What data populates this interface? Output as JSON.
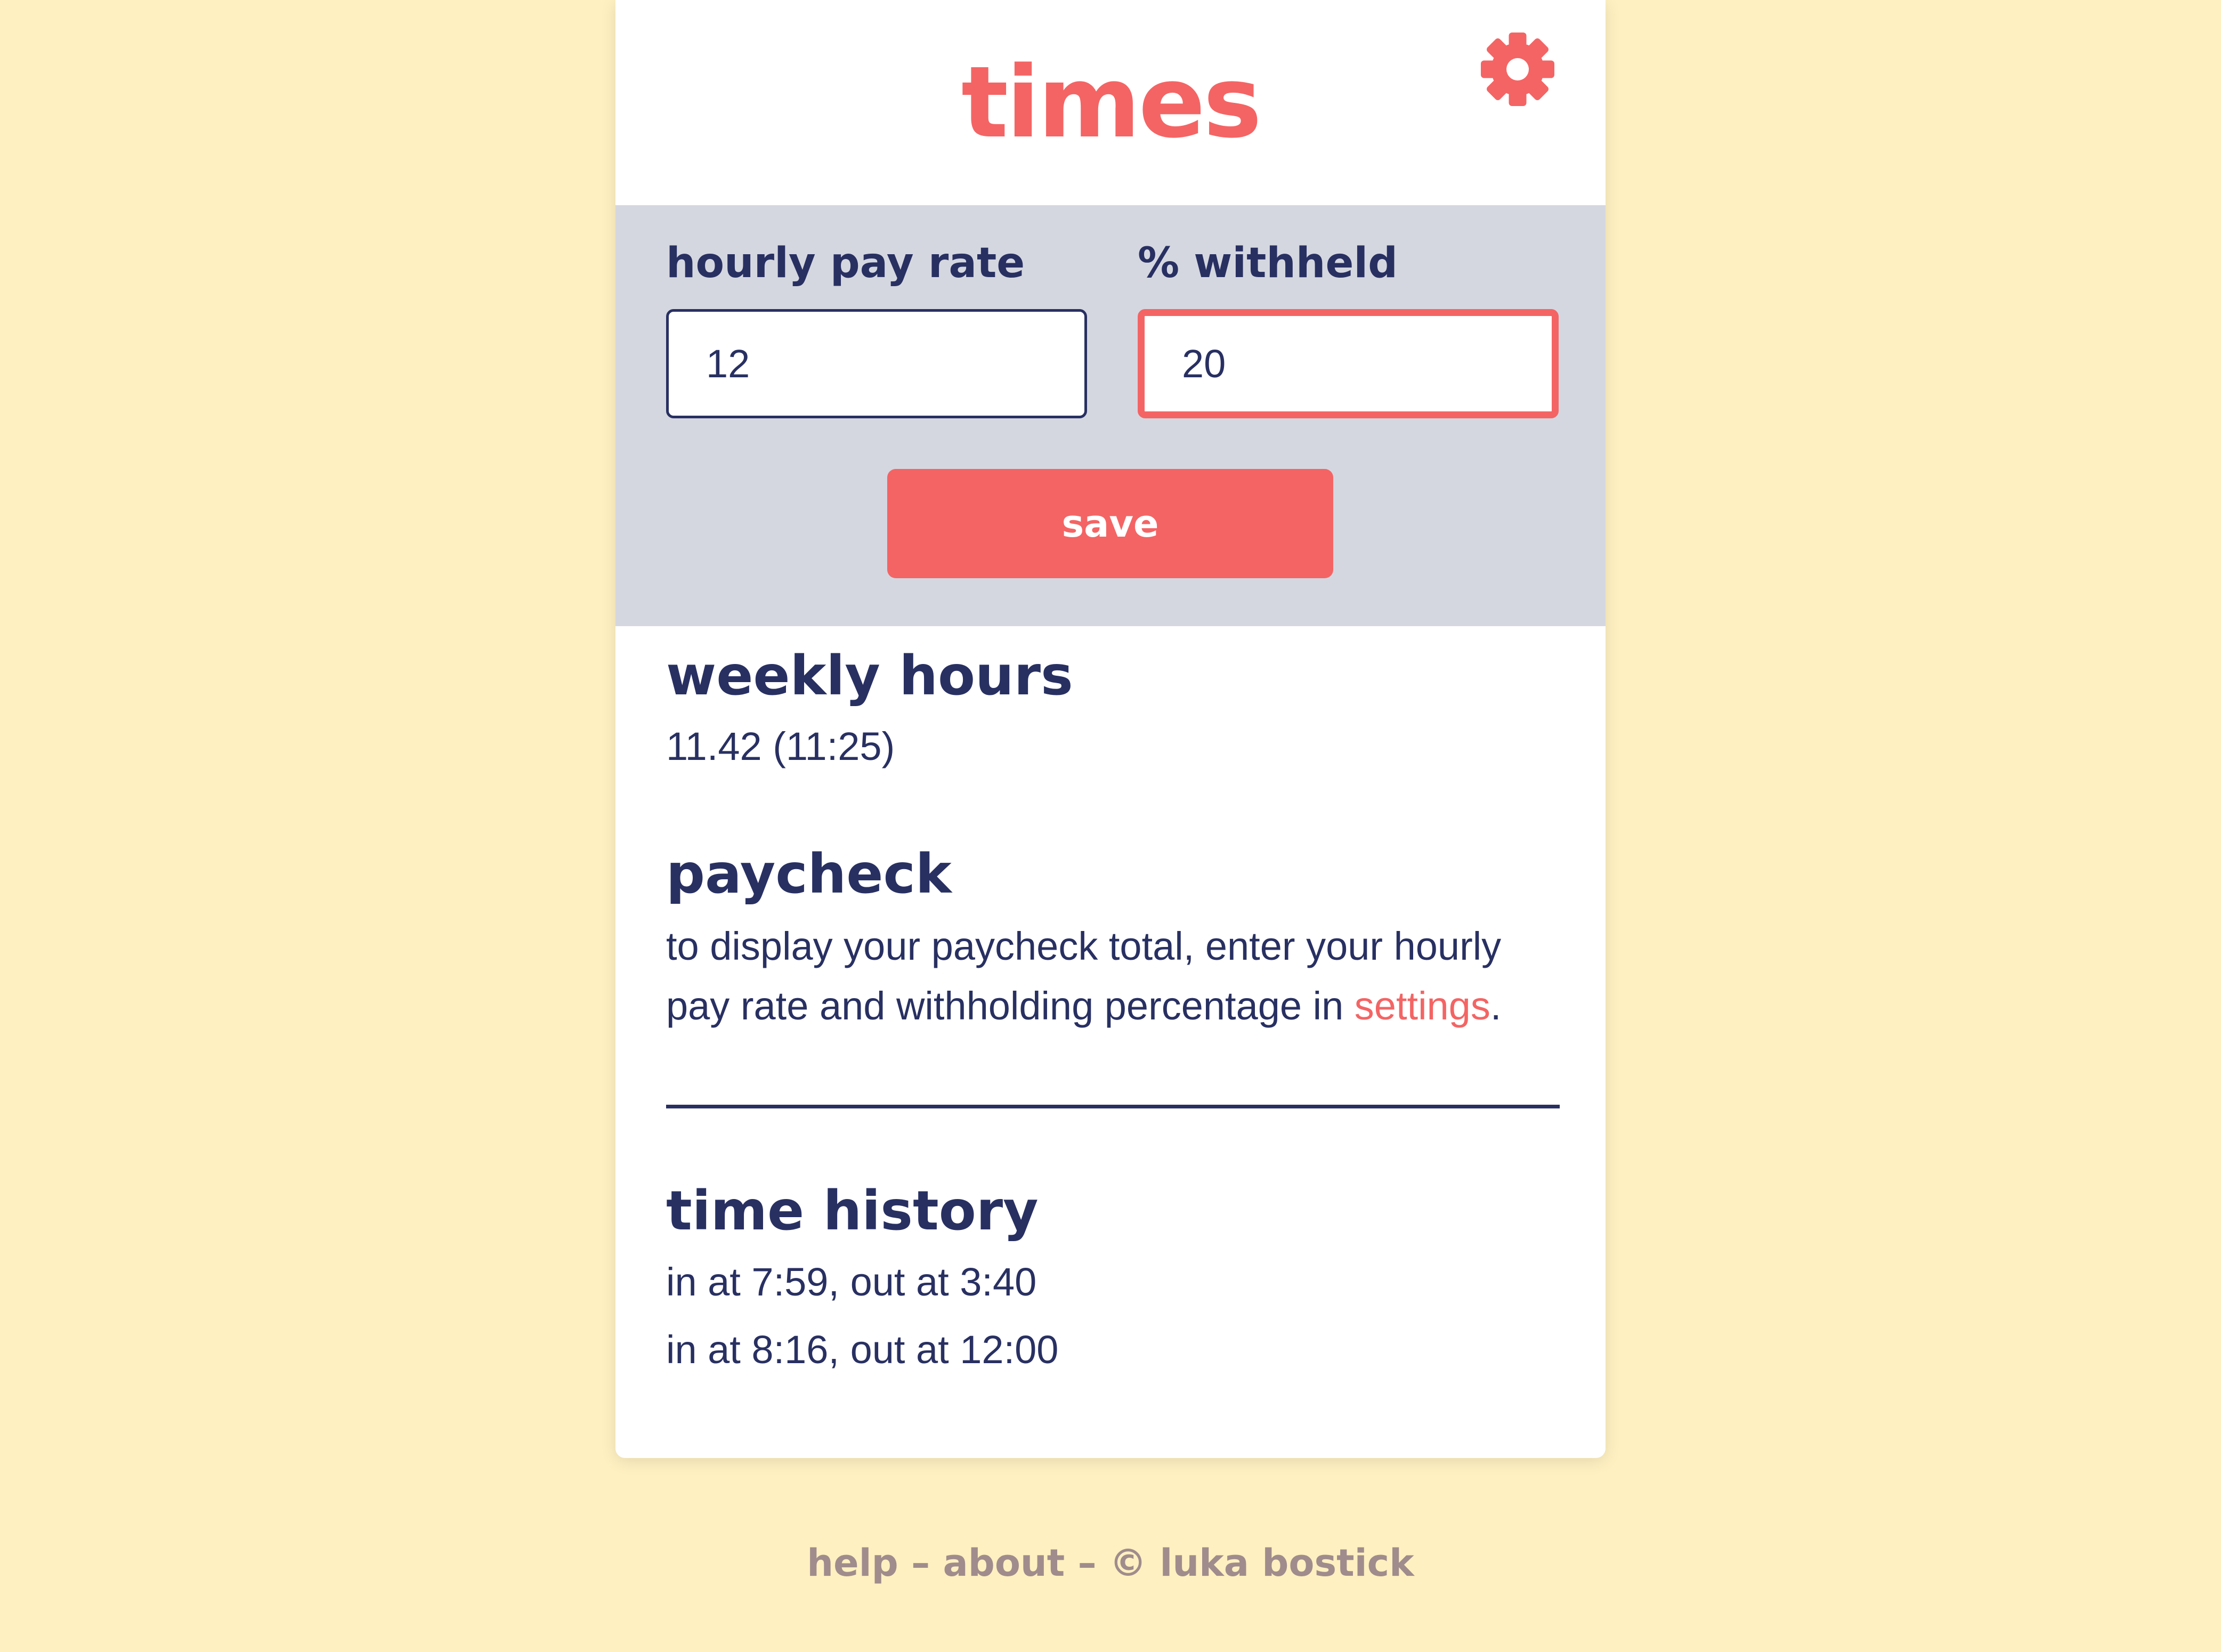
{
  "app": {
    "title": "times",
    "settings_icon": "gear-icon"
  },
  "settings": {
    "hourly_pay_rate": {
      "label": "hourly pay rate",
      "value": "12"
    },
    "percent_withheld": {
      "label": "% withheld",
      "value": "20"
    },
    "save_label": "save"
  },
  "weekly_hours": {
    "title": "weekly hours",
    "value": "11.42 (11:25)"
  },
  "paycheck": {
    "title": "paycheck",
    "message_before": "to display your paycheck total, enter your hourly pay rate and withholding percentage in ",
    "settings_link": "settings",
    "message_after": "."
  },
  "time_history": {
    "title": "time history",
    "entries": [
      "in at 7:59, out at 3:40",
      "in at 8:16, out at 12:00"
    ]
  },
  "footer": {
    "help": "help",
    "sep1": " – ",
    "about": "about",
    "sep2": " – ",
    "copyright": "© luka bostick"
  },
  "colors": {
    "background": "#FEF0C1",
    "accent": "#F46464",
    "text": "#283062",
    "panel": "#D5D7E0",
    "footer_text": "#A08C8C"
  }
}
